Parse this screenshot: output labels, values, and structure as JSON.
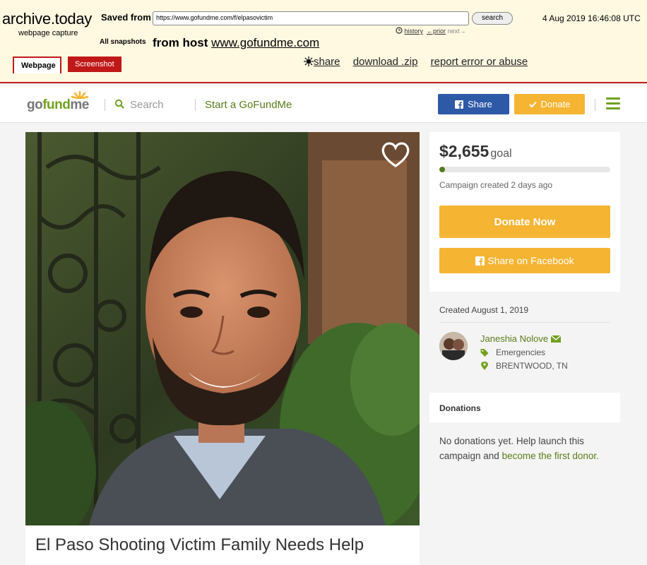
{
  "archive": {
    "brand": "archive.today",
    "subtitle": "webpage capture",
    "saved_from_label": "Saved from",
    "url": "https://www.gofundme.com/f/elpasovictim",
    "search_label": "search",
    "timestamp": "4 Aug 2019 16:46:08 UTC",
    "history_label": "history",
    "prior_label": "←prior",
    "next_label": "next→",
    "all_snapshots_label": "All snapshots",
    "from_host_label": "from host",
    "host": "www.gofundme.com",
    "tabs": [
      "Webpage",
      "Screenshot"
    ],
    "share_label": "share",
    "download_label": "download .zip",
    "report_label": "report error or abuse"
  },
  "nav": {
    "logo_go": "go",
    "logo_fund": "fund",
    "logo_me": "me",
    "search_placeholder": "Search",
    "start_label": "Start a GoFundMe",
    "share_label": "Share",
    "donate_label": "Donate"
  },
  "campaign": {
    "title": "El Paso Shooting Victim Family Needs Help",
    "amount": "$2,655",
    "goal_label": "goal",
    "progress_fraction": 0.02,
    "created_ago": "Campaign created 2 days ago",
    "donate_now_label": "Donate Now",
    "share_facebook_label": "Share on Facebook",
    "created_date": "Created August 1, 2019",
    "organizer_name": "Janeshia Nolove",
    "category": "Emergencies",
    "location": "BRENTWOOD, TN",
    "donations_heading": "Donations",
    "no_donations_text": "No donations yet. Help launch this campaign and ",
    "first_donor_link": "become the first donor."
  },
  "colors": {
    "archive_bg": "#fff9e1",
    "archive_red": "#c01818",
    "gfm_green": "#71a11f",
    "gfm_yellow": "#f5b432",
    "facebook_blue": "#2d59a7"
  }
}
